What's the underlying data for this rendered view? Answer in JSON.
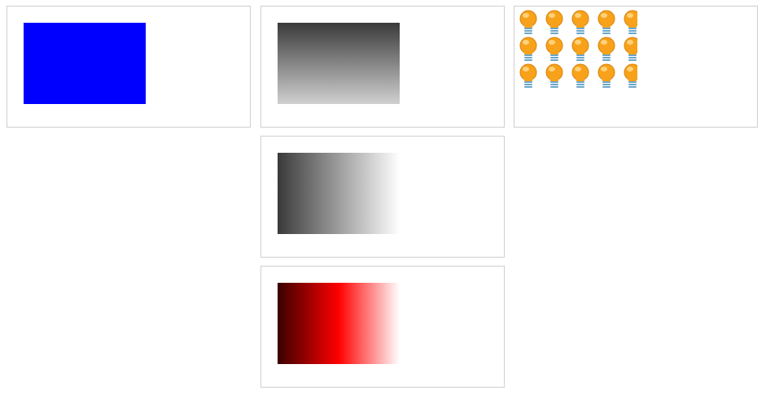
{
  "panels": [
    {
      "name": "solid-fill-panel",
      "fill": {
        "type": "solid",
        "colors": [
          "#0000ff"
        ]
      }
    },
    {
      "name": "vertical-gray-gradient-panel",
      "fill": {
        "type": "linear-gradient",
        "direction": "top-to-bottom",
        "colors": [
          "#3a3a3a",
          "#d0d0d0"
        ]
      }
    },
    {
      "name": "tiled-bulb-pattern-panel",
      "fill": {
        "type": "tiled-image",
        "icon": "lightbulb-icon",
        "colors": [
          "#f7a21a",
          "#ffd27a",
          "#6aa6c8"
        ]
      }
    },
    {
      "name": "horizontal-gray-gradient-panel",
      "fill": {
        "type": "linear-gradient",
        "direction": "left-to-right",
        "colors": [
          "#3a3a3a",
          "#ffffff"
        ]
      }
    },
    {
      "name": "horizontal-red-gradient-panel",
      "fill": {
        "type": "linear-gradient",
        "direction": "left-to-right",
        "colors": [
          "#3a0000",
          "#ff0000",
          "#ffffff"
        ]
      }
    }
  ]
}
